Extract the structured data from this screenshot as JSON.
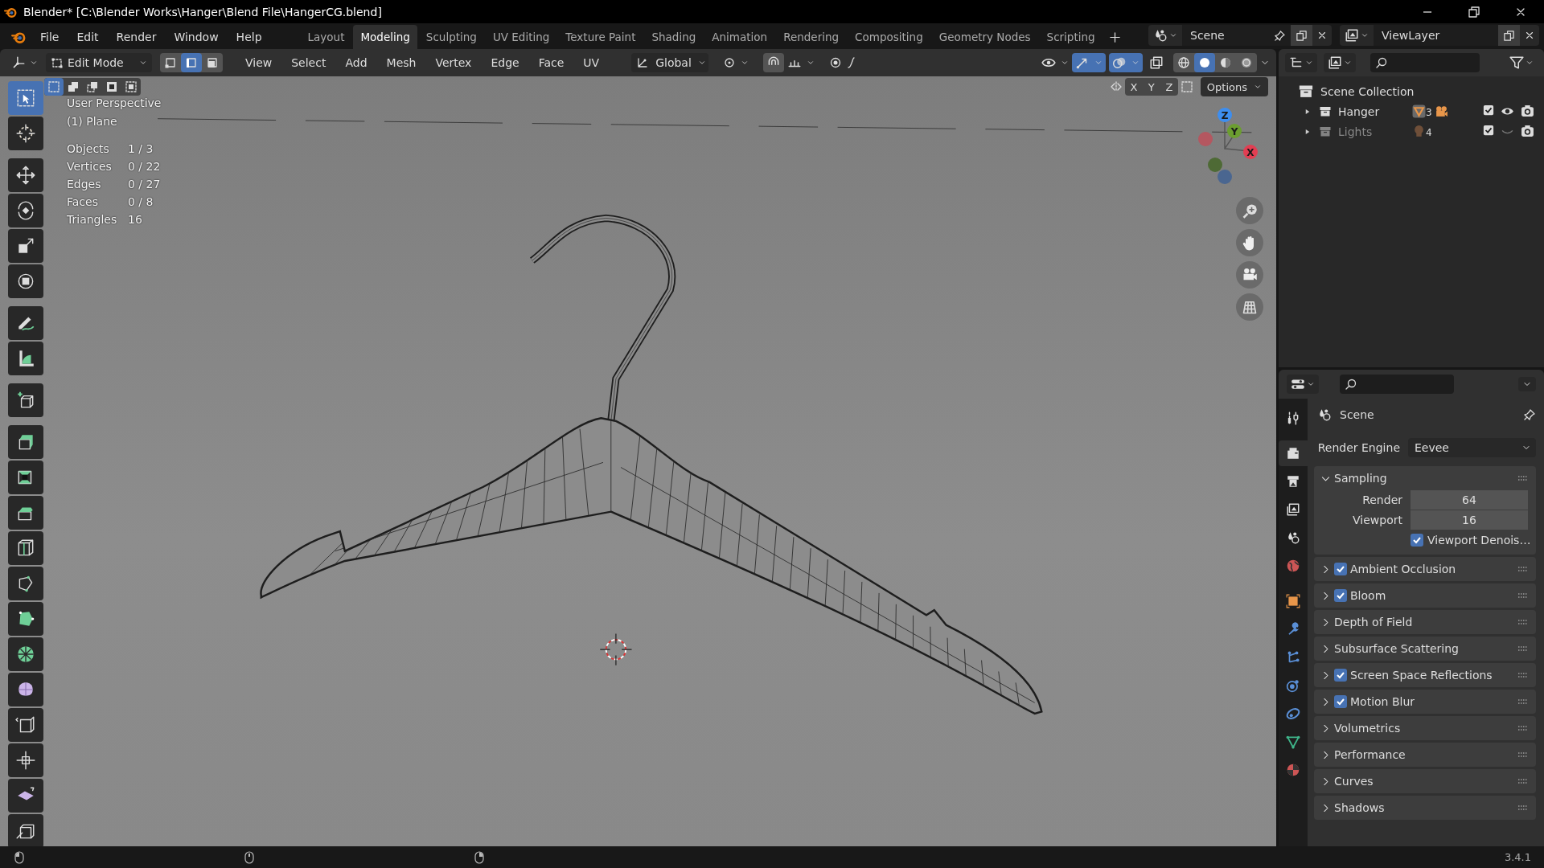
{
  "window": {
    "title": "Blender* [C:\\Blender Works\\Hanger\\Blend File\\HangerCG.blend]"
  },
  "menus": [
    "File",
    "Edit",
    "Render",
    "Window",
    "Help"
  ],
  "workspaces": [
    {
      "label": "Layout",
      "selected": false
    },
    {
      "label": "Modeling",
      "selected": true
    },
    {
      "label": "Sculpting",
      "selected": false
    },
    {
      "label": "UV Editing",
      "selected": false
    },
    {
      "label": "Texture Paint",
      "selected": false
    },
    {
      "label": "Shading",
      "selected": false
    },
    {
      "label": "Animation",
      "selected": false
    },
    {
      "label": "Rendering",
      "selected": false
    },
    {
      "label": "Compositing",
      "selected": false
    },
    {
      "label": "Geometry Nodes",
      "selected": false
    },
    {
      "label": "Scripting",
      "selected": false
    }
  ],
  "scene": "Scene",
  "view_layer": "ViewLayer",
  "header": {
    "mode": "Edit Mode",
    "select_modes": [
      {
        "kind": "vertex",
        "selected": false
      },
      {
        "kind": "edge",
        "selected": true
      },
      {
        "kind": "face",
        "selected": false
      }
    ],
    "menus": [
      "View",
      "Select",
      "Add",
      "Mesh",
      "Vertex",
      "Edge",
      "Face",
      "UV"
    ],
    "orientation": "Global",
    "toggles": [
      {
        "kind": "gizmo",
        "on": true
      },
      {
        "kind": "overlay",
        "on": true
      },
      {
        "kind": "xray",
        "on": false
      }
    ],
    "shading": [
      {
        "kind": "wireframe",
        "selected": false
      },
      {
        "kind": "solid",
        "selected": true
      },
      {
        "kind": "material",
        "selected": false
      },
      {
        "kind": "rendered",
        "selected": false
      }
    ]
  },
  "tool_settings": {
    "box_modes": [
      {
        "selected": true
      },
      {
        "selected": false
      },
      {
        "selected": false
      },
      {
        "selected": false
      },
      {
        "selected": false
      }
    ],
    "mirror_axes": [
      "X",
      "Y",
      "Z"
    ],
    "options": "Options"
  },
  "tools": [
    {
      "kind": "select",
      "selected": true
    },
    {
      "kind": "cursor",
      "selected": false
    },
    {
      "kind": "move",
      "selected": false
    },
    {
      "kind": "rotate",
      "selected": false
    },
    {
      "kind": "scale",
      "selected": false
    },
    {
      "kind": "transform",
      "selected": false
    },
    {
      "kind": "annotate",
      "selected": false
    },
    {
      "kind": "measure",
      "selected": false
    },
    {
      "kind": "addcube",
      "selected": false
    },
    {
      "kind": "extrude",
      "selected": false
    },
    {
      "kind": "inset",
      "selected": false
    },
    {
      "kind": "bevel",
      "selected": false
    },
    {
      "kind": "loopcut",
      "selected": false
    },
    {
      "kind": "knife",
      "selected": false
    },
    {
      "kind": "polybuild",
      "selected": false
    },
    {
      "kind": "spin",
      "selected": false
    },
    {
      "kind": "smooth",
      "selected": false
    },
    {
      "kind": "slide",
      "selected": false
    },
    {
      "kind": "shrink",
      "selected": false
    },
    {
      "kind": "shear",
      "selected": false
    },
    {
      "kind": "rip",
      "selected": false
    }
  ],
  "viewport": {
    "perspective": "User Perspective",
    "object": "(1) Plane",
    "stats": [
      {
        "label": "Objects",
        "value": "1 / 3"
      },
      {
        "label": "Vertices",
        "value": "0 / 22"
      },
      {
        "label": "Edges",
        "value": "0 / 27"
      },
      {
        "label": "Faces",
        "value": "0 / 8"
      },
      {
        "label": "Triangles",
        "value": "16"
      }
    ],
    "gizmo_axes": [
      "X",
      "Y",
      "Z"
    ]
  },
  "outliner": {
    "root": "Scene Collection",
    "items": [
      {
        "name": "Hanger",
        "badges": [
          {
            "kind": "mesh",
            "count": "3"
          },
          {
            "kind": "camera"
          }
        ],
        "checked": true,
        "visible": true
      },
      {
        "name": "Lights",
        "badges": [
          {
            "kind": "light",
            "count": "4"
          }
        ],
        "checked": true,
        "visible": false
      }
    ]
  },
  "properties": {
    "tabs": [
      {
        "kind": "tool",
        "selected": false
      },
      {
        "kind": "render",
        "selected": true
      },
      {
        "kind": "output",
        "selected": false
      },
      {
        "kind": "viewlayer",
        "selected": false
      },
      {
        "kind": "scene",
        "selected": false
      },
      {
        "kind": "world",
        "selected": false
      },
      {
        "kind": "object",
        "selected": false
      },
      {
        "kind": "modifier",
        "selected": false
      },
      {
        "kind": "particles",
        "selected": false
      },
      {
        "kind": "physics",
        "selected": false
      },
      {
        "kind": "constraints",
        "selected": false
      },
      {
        "kind": "data",
        "selected": false
      },
      {
        "kind": "material",
        "selected": false
      }
    ],
    "context": "Scene",
    "engine_label": "Render Engine",
    "engine": "Eevee",
    "panels": [
      {
        "kind": "fields",
        "title": "Sampling",
        "expanded": true,
        "fields": [
          {
            "label": "Render",
            "value": "64"
          },
          {
            "label": "Viewport",
            "value": "16"
          }
        ],
        "option": {
          "label": "Viewport Denois…",
          "checked": true
        }
      },
      {
        "kind": "toggle",
        "title": "Ambient Occlusion",
        "expanded": false,
        "checked": true
      },
      {
        "kind": "toggle",
        "title": "Bloom",
        "expanded": false,
        "checked": true
      },
      {
        "kind": "plain",
        "title": "Depth of Field",
        "expanded": false
      },
      {
        "kind": "plain",
        "title": "Subsurface Scattering",
        "expanded": false
      },
      {
        "kind": "toggle",
        "title": "Screen Space Reflections",
        "expanded": false,
        "checked": true
      },
      {
        "kind": "toggle",
        "title": "Motion Blur",
        "expanded": false,
        "checked": true
      },
      {
        "kind": "plain",
        "title": "Volumetrics",
        "expanded": false
      },
      {
        "kind": "plain",
        "title": "Performance",
        "expanded": false
      },
      {
        "kind": "plain",
        "title": "Curves",
        "expanded": false
      },
      {
        "kind": "plain",
        "title": "Shadows",
        "expanded": false
      }
    ]
  },
  "status_bar": {
    "version": "3.4.1"
  }
}
